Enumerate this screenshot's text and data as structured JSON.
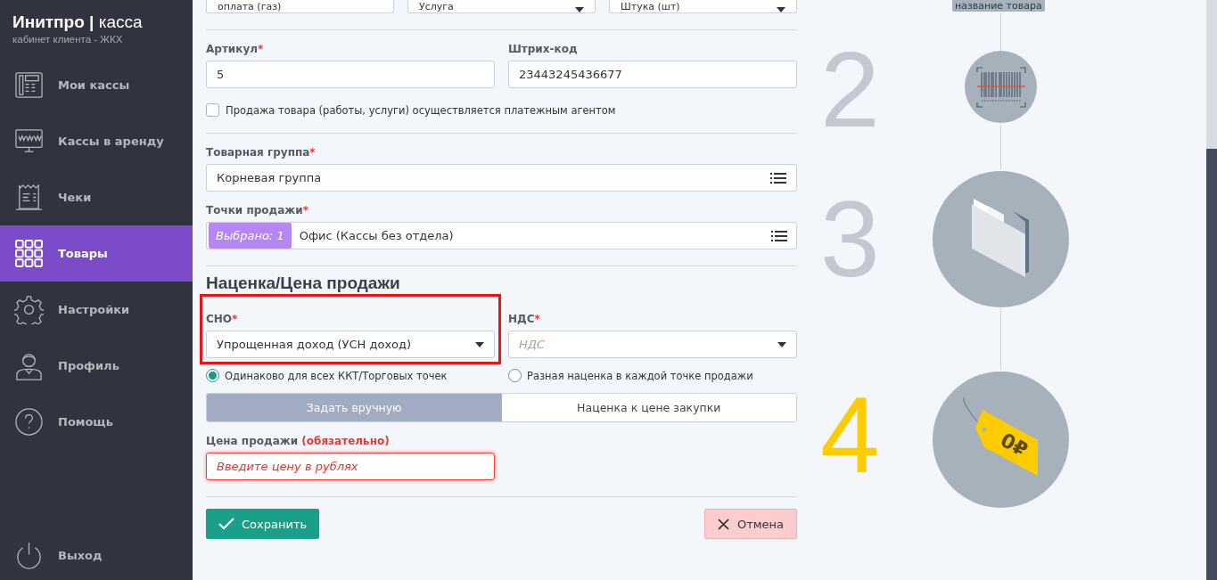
{
  "sidebar": {
    "brand": "**Инитпро |** касса",
    "subtitle": "кабинет клиента - ЖКХ",
    "items": [
      {
        "label": "Мои кассы",
        "selected": false
      },
      {
        "label": "Кассы в аренду",
        "selected": false
      },
      {
        "label": "Чеки",
        "selected": false
      },
      {
        "label": "Товары",
        "selected": true
      },
      {
        "label": "Настройки",
        "selected": false
      },
      {
        "label": "Профиль",
        "selected": false
      },
      {
        "label": "Помощь",
        "selected": false
      }
    ],
    "logout": {
      "label": "Выход"
    }
  },
  "form": {
    "top_row": [
      {
        "value": "оплата (газ)",
        "kind": "input"
      },
      {
        "value": "Услуга",
        "kind": "select"
      },
      {
        "value": "Штука (шт)",
        "kind": "select"
      }
    ],
    "article": {
      "label": "Артикул",
      "required_mark": "*",
      "value": "5"
    },
    "barcode": {
      "label": "Штрих-код",
      "value": "23443245436677"
    },
    "agent": {
      "label": "Продажа товара (работы, услуги) осуществляется платежным агентом",
      "checked": false
    },
    "group": {
      "label": "Товарная группа",
      "required_mark": "*",
      "value": "Корневая группа"
    },
    "points": {
      "label": "Точки продажи",
      "required_mark": "*",
      "chip": "Выбрано: 1",
      "value": "Офис (Кассы без отдела)"
    },
    "section_title": "Наценка/Цена продажи",
    "sno": {
      "label": "СНО",
      "required_mark": "*",
      "value": "Упрощенная доход (УСН доход)",
      "highlighted": true
    },
    "vat": {
      "label": "НДС",
      "required_mark": "*",
      "placeholder": "НДС"
    },
    "radios": [
      {
        "label": "Одинаково для всех ККТ/Торговых точек",
        "selected": true
      },
      {
        "label": "Разная наценка в каждой точке продажи",
        "selected": false
      }
    ],
    "modes": [
      {
        "label": "Задать вручную",
        "selected": true
      },
      {
        "label": "Наценка к цене закупки",
        "selected": false
      }
    ],
    "price": {
      "label": "Цена продажи",
      "note": "(обязательно)",
      "placeholder": "Введите цену в рублях",
      "error": true
    },
    "save": "Сохранить",
    "cancel": "Отмена"
  },
  "steps": [
    {
      "kind": "label",
      "label": "название товара"
    },
    {
      "number": "2",
      "kind": "barcode",
      "active": false
    },
    {
      "number": "3",
      "kind": "folder",
      "active": false
    },
    {
      "number": "4",
      "kind": "price-tag",
      "tag_text": "0₽",
      "active": true
    }
  ]
}
